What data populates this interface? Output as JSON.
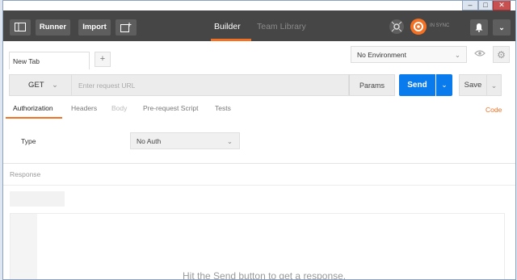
{
  "topbar": {
    "runner_label": "Runner",
    "import_label": "Import",
    "tabs": [
      {
        "label": "Builder",
        "active": true
      },
      {
        "label": "Team Library",
        "active": false
      }
    ],
    "sync_label": "IN SYNC",
    "accent_color": "#f47023"
  },
  "request_tabs": {
    "tabs": [
      {
        "label": "New Tab"
      }
    ],
    "add_label": "+"
  },
  "environment": {
    "selected": "No Environment"
  },
  "request": {
    "method": "GET",
    "url_placeholder": "Enter request URL",
    "params_label": "Params",
    "send_label": "Send",
    "send_color": "#097bed",
    "save_label": "Save"
  },
  "subtabs": {
    "items": [
      {
        "label": "Authorization",
        "state": "active"
      },
      {
        "label": "Headers",
        "state": "normal"
      },
      {
        "label": "Body",
        "state": "disabled"
      },
      {
        "label": "Pre-request Script",
        "state": "normal"
      },
      {
        "label": "Tests",
        "state": "normal"
      }
    ],
    "code_label": "Code"
  },
  "auth": {
    "type_label": "Type",
    "type_value": "No Auth"
  },
  "response": {
    "label": "Response",
    "hint": "Hit the Send button to get a response."
  }
}
